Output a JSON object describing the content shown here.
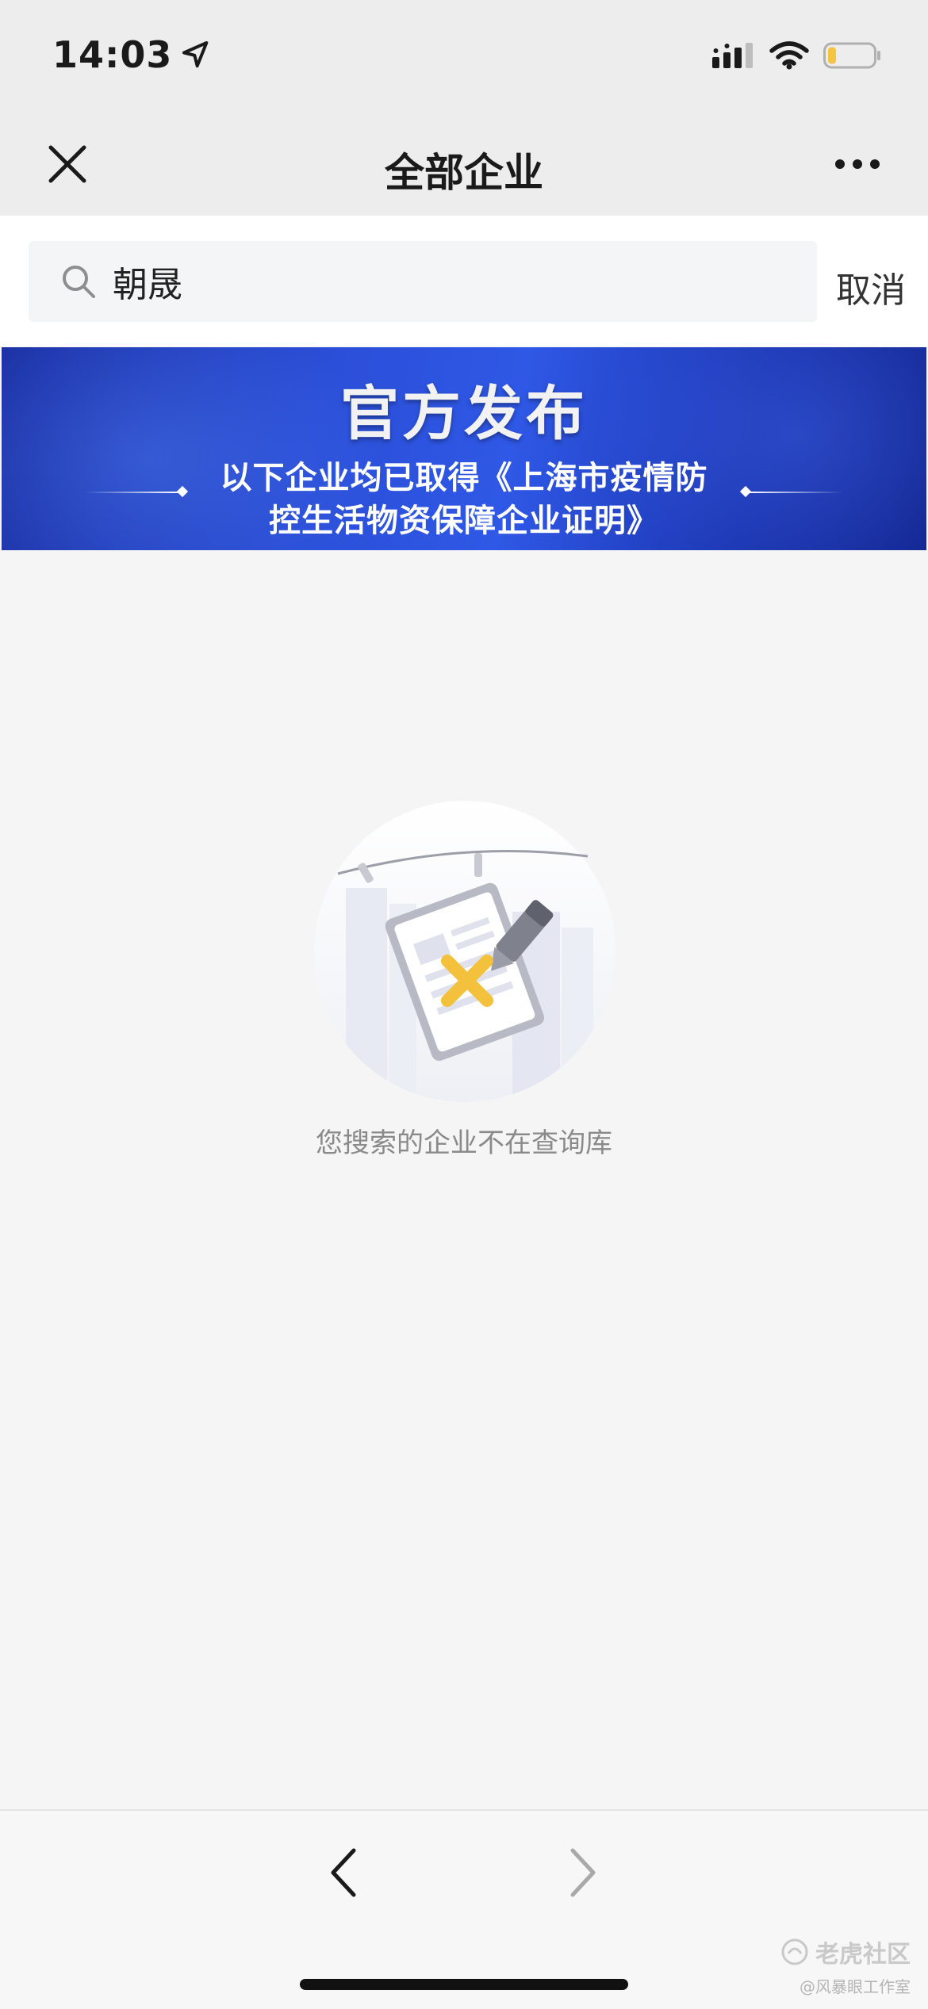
{
  "status_bar": {
    "time": "14:03",
    "location_icon": "location-arrow-icon",
    "signal_icon": "cellular-signal-icon",
    "wifi_icon": "wifi-icon",
    "battery_icon": "battery-icon",
    "battery_color": "#f4c542"
  },
  "nav": {
    "title": "全部企业",
    "close_icon": "close-icon",
    "more_icon": "more-icon"
  },
  "search": {
    "value": "朝晟",
    "cancel_label": "取消",
    "icon": "search-icon"
  },
  "banner": {
    "title": "官方发布",
    "line1": "以下企业均已取得《上海市疫情防",
    "line2": "控生活物资保障企业证明》",
    "colors": {
      "start": "#1b2fa3",
      "end": "#142894"
    }
  },
  "empty_state": {
    "illustration_icon": "document-not-found-icon",
    "message": "您搜索的企业不在查询库",
    "accent": "#f3c13b"
  },
  "toolbar": {
    "back_icon": "chevron-left-icon",
    "forward_icon": "chevron-right-icon"
  },
  "watermark": {
    "main": "老虎社区",
    "sub": "@风暴眼工作室"
  }
}
